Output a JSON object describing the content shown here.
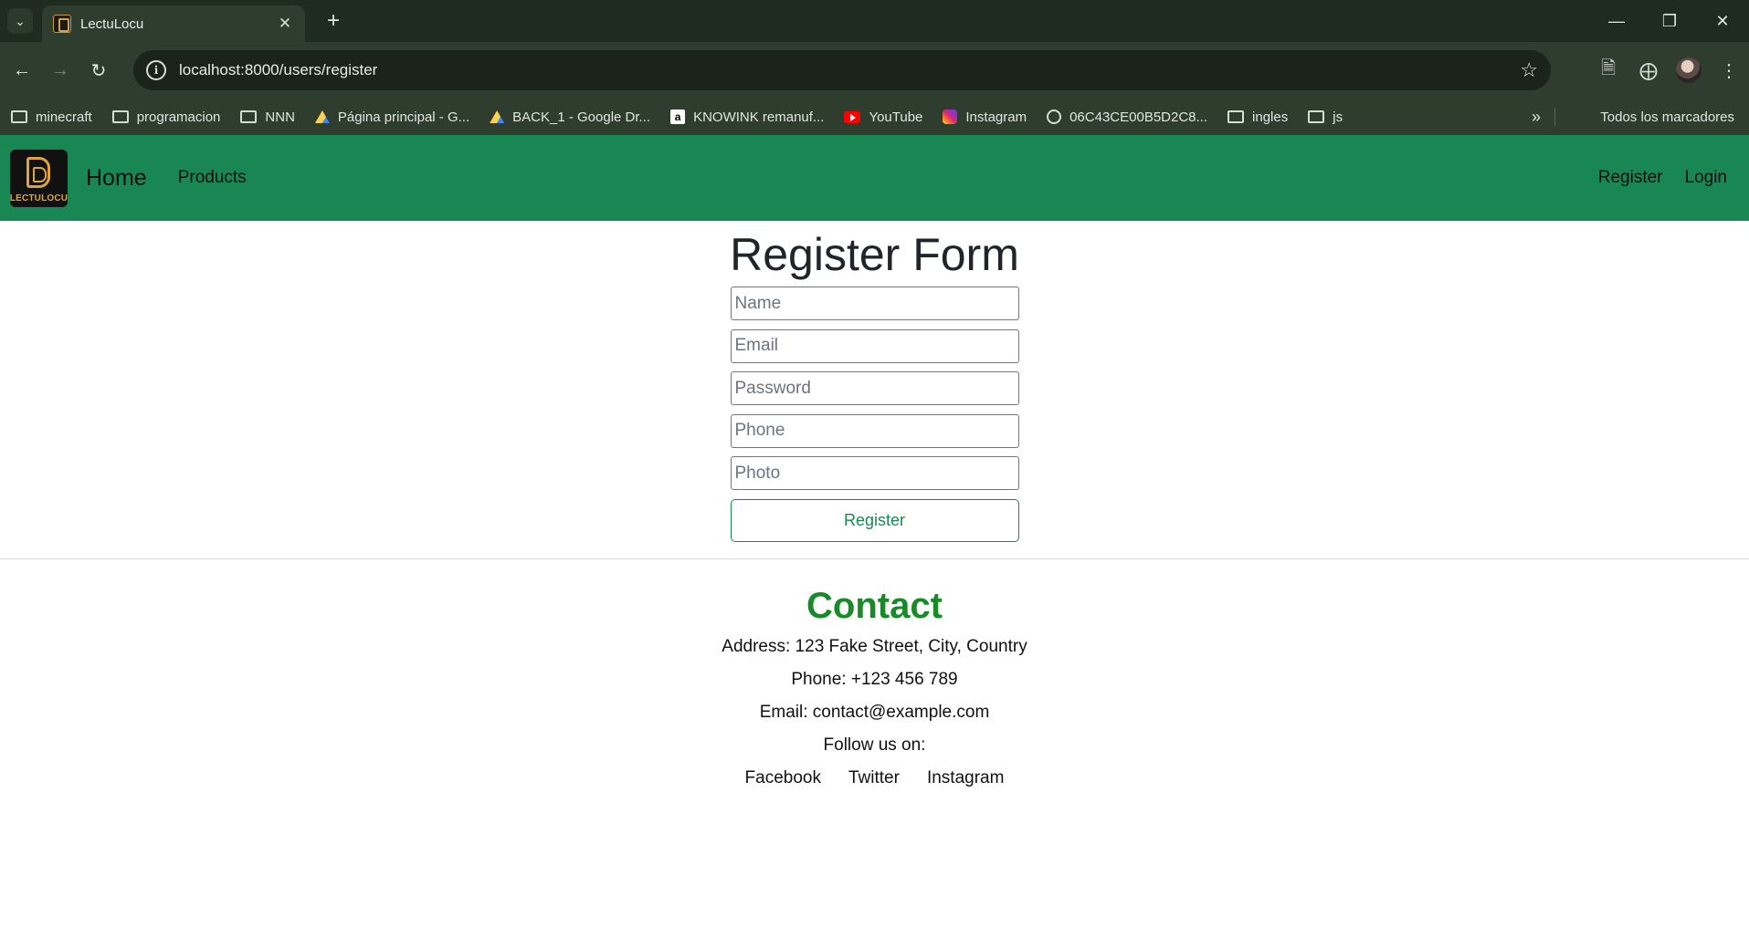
{
  "browser": {
    "tab_title": "LectuLocu",
    "url": "localhost:8000/users/register",
    "bookmarks": [
      {
        "label": "minecraft",
        "icon": "folder-icon"
      },
      {
        "label": "programacion",
        "icon": "folder-icon"
      },
      {
        "label": "NNN",
        "icon": "folder-icon"
      },
      {
        "label": "Página principal - G...",
        "icon": "google-drive-icon"
      },
      {
        "label": "BACK_1 - Google Dr...",
        "icon": "google-drive-icon"
      },
      {
        "label": "KNOWINK remanuf...",
        "icon": "amazon-icon"
      },
      {
        "label": "YouTube",
        "icon": "youtube-icon"
      },
      {
        "label": "Instagram",
        "icon": "instagram-icon"
      },
      {
        "label": "06C43CE00B5D2C8...",
        "icon": "globe-icon"
      },
      {
        "label": "ingles",
        "icon": "folder-icon"
      },
      {
        "label": "js",
        "icon": "folder-icon"
      }
    ],
    "all_bookmarks": "Todos los marcadores"
  },
  "nav": {
    "logo_text": "LECTULOCU",
    "home": "Home",
    "products": "Products",
    "register": "Register",
    "login": "Login",
    "bg_color": "#198754"
  },
  "form": {
    "title": "Register Form",
    "name_placeholder": "Name",
    "email_placeholder": "Email",
    "password_placeholder": "Password",
    "phone_placeholder": "Phone",
    "photo_placeholder": "Photo",
    "submit": "Register"
  },
  "contact": {
    "title": "Contact",
    "address": "Address: 123 Fake Street, City, Country",
    "phone": "Phone: +123 456 789",
    "email": "Email: contact@example.com",
    "follow": "Follow us on:",
    "social": [
      "Facebook",
      "Twitter",
      "Instagram"
    ]
  }
}
